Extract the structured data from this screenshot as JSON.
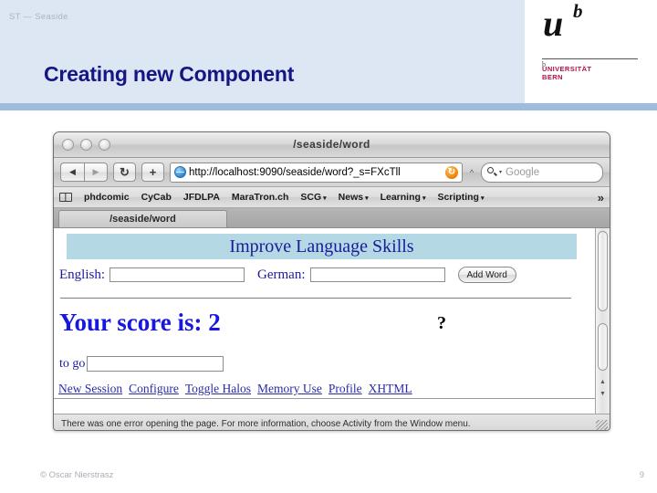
{
  "slide": {
    "breadcrumb": "ST — Seaside",
    "title": "Creating new Component",
    "title_color": "#151585",
    "header_bg": "#dde7f3",
    "accent_bar": "#9fbcdf",
    "footer_copyright": "© Oscar Nierstrasz",
    "page_number": "9"
  },
  "logo": {
    "glyph_u": "u",
    "glyph_b": "b",
    "tick": "b",
    "line1": "UNIVERSITÄT",
    "line2": "BERN",
    "color": "#b4114a"
  },
  "browser": {
    "window_title": "/seaside/word",
    "nav": {
      "back": "◀",
      "forward": "▶",
      "reload": "↻",
      "add": "+"
    },
    "address": {
      "url": "http://localhost:9090/seaside/word?_s=FXcTll",
      "site_icon": "globe-icon",
      "reload_icon": "↻",
      "bookmark_marker": "^"
    },
    "search": {
      "placeholder": "Google",
      "icon": "magnifier-icon",
      "caret": "▾"
    },
    "bookmarks": [
      {
        "label": "phdcomic",
        "menu": false
      },
      {
        "label": "CyCab",
        "menu": false
      },
      {
        "label": "JFDLPA",
        "menu": false
      },
      {
        "label": "MaraTron.ch",
        "menu": false
      },
      {
        "label": "SCG",
        "menu": true
      },
      {
        "label": "News",
        "menu": true
      },
      {
        "label": "Learning",
        "menu": true
      },
      {
        "label": "Scripting",
        "menu": true
      }
    ],
    "bookmarks_overflow": "»",
    "caret_glyph": "▾",
    "tab_label": "/seaside/word",
    "status_text": "There was one error opening the page. For more information, choose Activity from the Window menu."
  },
  "page": {
    "banner_title": "Improve Language Skills",
    "banner_bg": "#b4d9e4",
    "fields": [
      {
        "label": "English:",
        "value": ""
      },
      {
        "label": "German:",
        "value": ""
      }
    ],
    "add_word_button": "Add Word",
    "score_text": "Your score is: 2",
    "score_color": "#1717e0",
    "annotation": "?",
    "to_go_label": "to go",
    "to_go_value": "",
    "seaside_links": [
      "New Session",
      "Configure",
      "Toggle Halos",
      "Memory Use",
      "Profile",
      "XHTML"
    ]
  }
}
